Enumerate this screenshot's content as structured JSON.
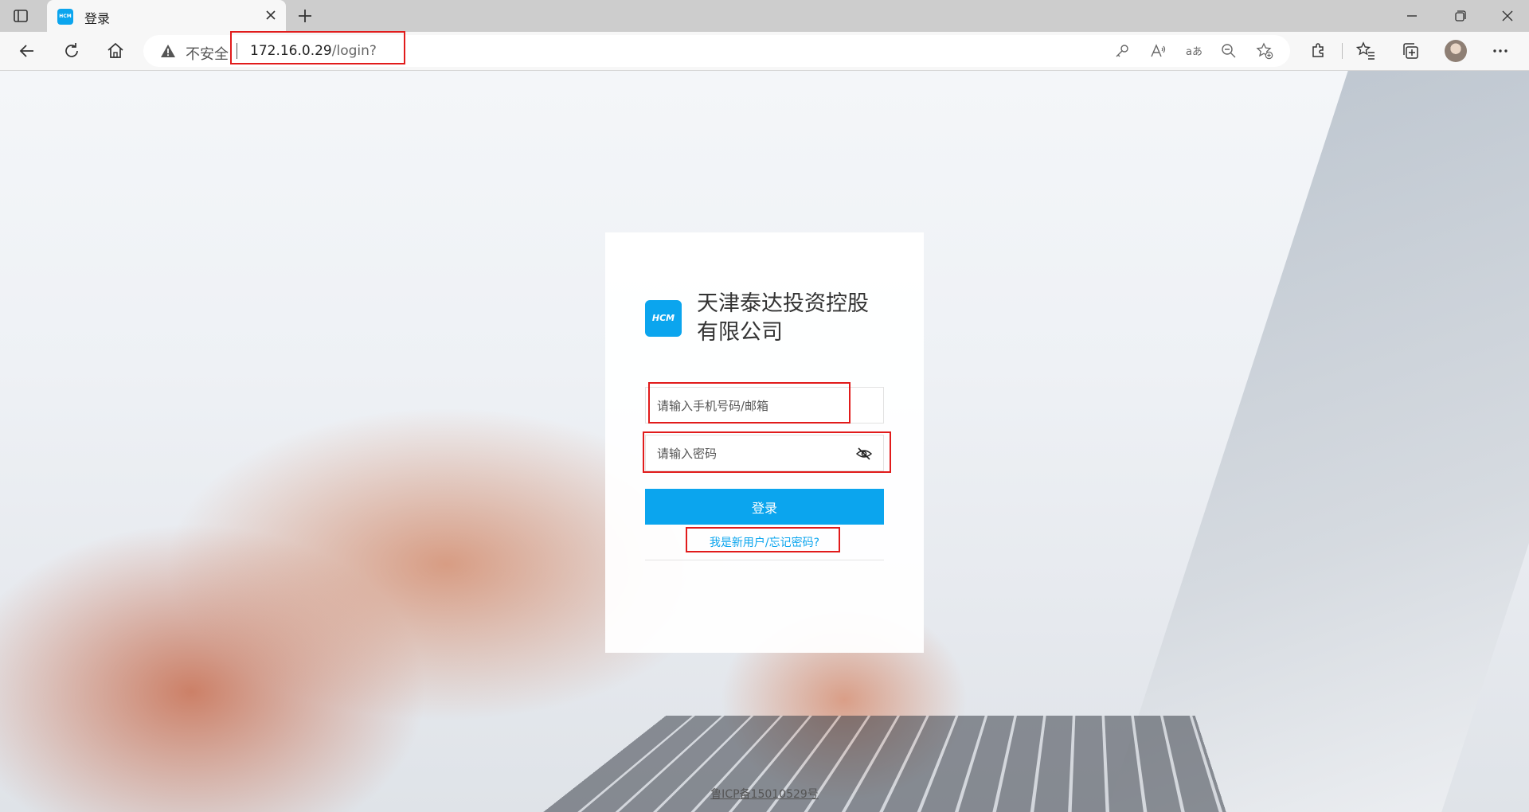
{
  "browser": {
    "tab_title": "登录",
    "favicon_text": "HCM",
    "security_label": "不安全",
    "url_host": "172.16.0.29",
    "url_path": "/login?",
    "toolbar_icons": [
      "key-icon",
      "read-aloud-icon",
      "translate-icon",
      "zoom-out-icon",
      "add-favorite-icon",
      "extensions-icon",
      "favorites-icon",
      "collections-icon",
      "profile-avatar",
      "more-options-icon"
    ]
  },
  "login": {
    "logo_text": "HCM",
    "company_name": "天津泰达投资控股有限公司",
    "phone_placeholder": "请输入手机号码/邮箱",
    "phone_value": "",
    "password_placeholder": "请输入密码",
    "password_value": "",
    "login_label": "登录",
    "help_link": "我是新用户/忘记密码?"
  },
  "footer": {
    "icp": "鲁ICP备15010529号"
  },
  "colors": {
    "accent": "#0ba5ee",
    "highlight": "#e11b1b"
  }
}
